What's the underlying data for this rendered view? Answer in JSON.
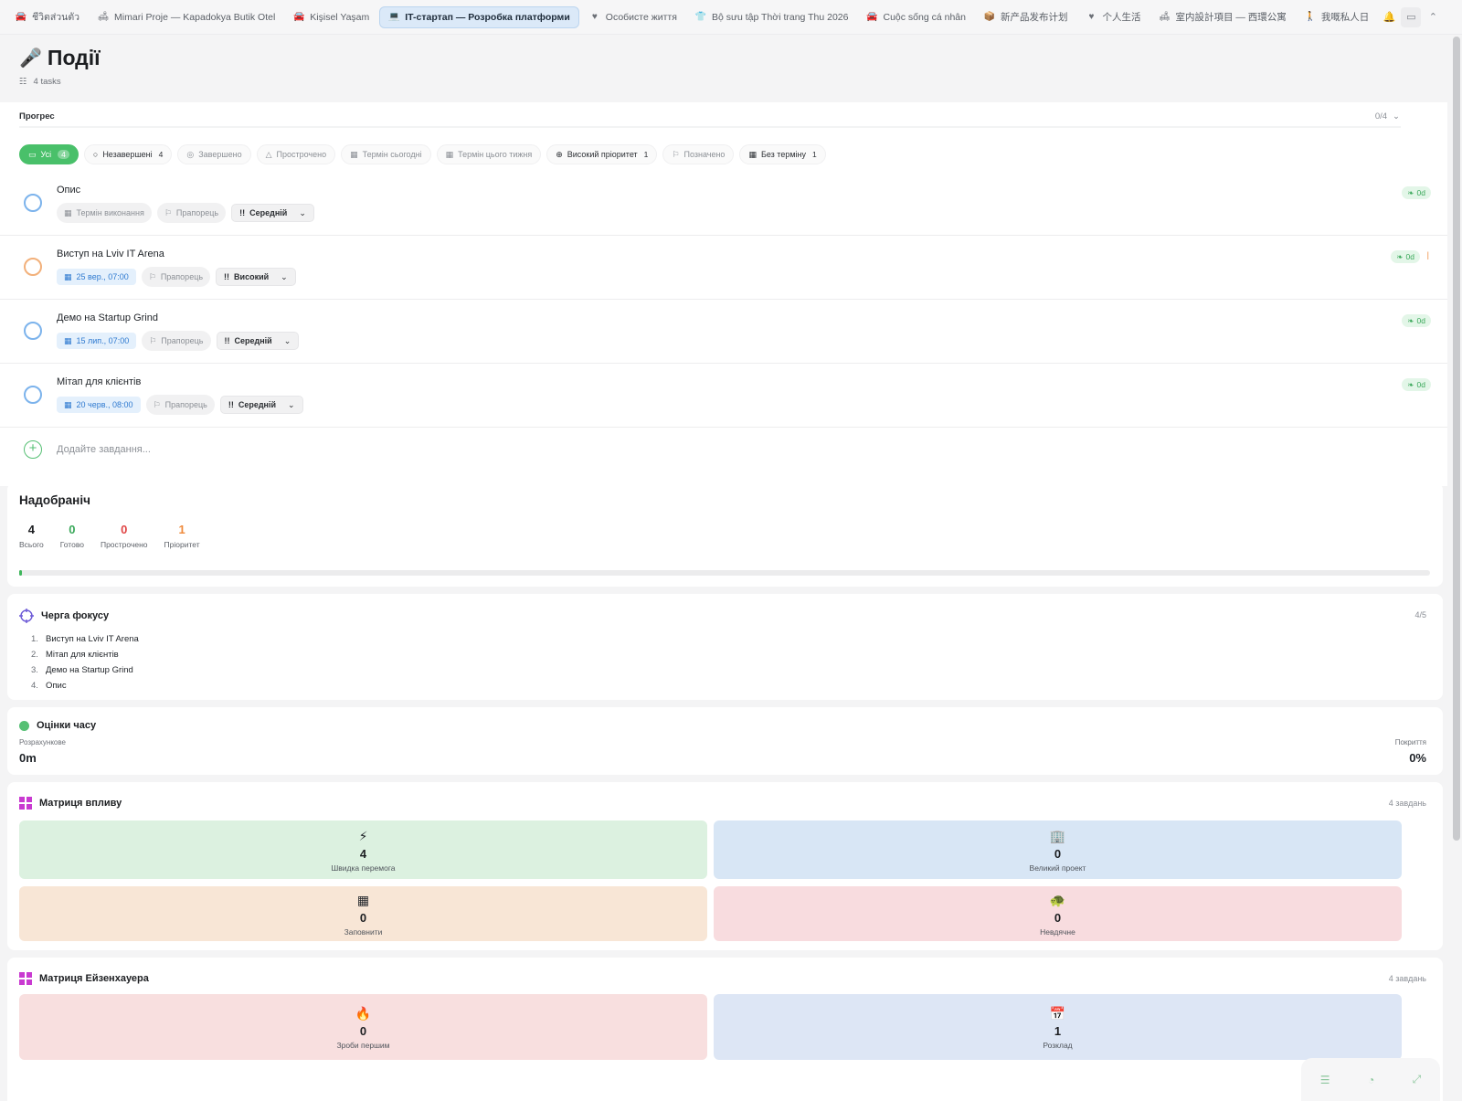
{
  "tabs": [
    {
      "label": "ชีวิตส่วนตัว",
      "icon": "car-icon",
      "glyph": "🚘"
    },
    {
      "label": "Mimari Proje — Kapadokya Butik Otel",
      "icon": "sofa-icon",
      "glyph": "🛋"
    },
    {
      "label": "Kişisel Yaşam",
      "icon": "car-icon",
      "glyph": "🚘"
    },
    {
      "label": "IT-стартап — Розробка платформи",
      "icon": "laptop-icon",
      "glyph": "💻",
      "active": true
    },
    {
      "label": "Особисте життя",
      "icon": "heart-icon",
      "glyph": "♥"
    },
    {
      "label": "Bộ sưu tập Thời trang Thu 2026",
      "icon": "shirt-icon",
      "glyph": "👕"
    },
    {
      "label": "Cuộc sống cá nhân",
      "icon": "car-icon",
      "glyph": "🚘"
    },
    {
      "label": "新产品发布计划",
      "icon": "box-icon",
      "glyph": "📦"
    },
    {
      "label": "个人生活",
      "icon": "heart-icon",
      "glyph": "♥"
    },
    {
      "label": "室内設計項目 — 西環公寓",
      "icon": "sofa-icon",
      "glyph": "🛋"
    },
    {
      "label": "我嘅私人日",
      "icon": "walking-icon",
      "glyph": "🚶"
    }
  ],
  "header": {
    "title": "Події",
    "title_icon": "microphone-icon",
    "subtitle": "4 tasks"
  },
  "progress": {
    "label": "Прогрес",
    "count": "0/4",
    "value": 0.0
  },
  "filters": [
    {
      "label": "Усі",
      "count": "4",
      "icon": "inbox-icon",
      "active": true
    },
    {
      "label": "Незавершені",
      "count": "4",
      "icon": "circle-icon",
      "dark": true
    },
    {
      "label": "Завершено",
      "count": "",
      "icon": "check-circle-icon"
    },
    {
      "label": "Прострочено",
      "count": "",
      "icon": "warning-icon"
    },
    {
      "label": "Термін сьогодні",
      "count": "",
      "icon": "calendar-icon"
    },
    {
      "label": "Термін цього тижня",
      "count": "",
      "icon": "calendar-icon"
    },
    {
      "label": "Високий пріоритет",
      "count": "1",
      "icon": "arrow-up-circle-icon",
      "dark": true
    },
    {
      "label": "Позначено",
      "count": "",
      "icon": "flag-icon"
    },
    {
      "label": "Без терміну",
      "count": "1",
      "icon": "calendar-off-icon",
      "dark": true
    }
  ],
  "tasks": [
    {
      "name": "Опис",
      "date": "Термін виконання",
      "has_date": false,
      "flag": "Прапорець",
      "priority": "Середній",
      "badge": "0d",
      "ring": "blue"
    },
    {
      "name": "Виступ на Lviv IT Arena",
      "date": "25 вер., 07:00",
      "has_date": true,
      "flag": "Прапорець",
      "priority": "Високий",
      "badge": "0d",
      "ring": "orange"
    },
    {
      "name": "Демо на Startup Grind",
      "date": "15 лип., 07:00",
      "has_date": true,
      "flag": "Прапорець",
      "priority": "Середній",
      "badge": "0d",
      "ring": "blue"
    },
    {
      "name": "Мітап для клієнтів",
      "date": "20 черв., 08:00",
      "has_date": true,
      "flag": "Прапорець",
      "priority": "Середній",
      "badge": "0d",
      "ring": "blue"
    }
  ],
  "add_task": {
    "placeholder": "Додайте завдання..."
  },
  "overview": {
    "title": "Надобраніч",
    "stats": [
      {
        "value": "4",
        "label": "Всього",
        "color": "#1c1e21"
      },
      {
        "value": "0",
        "label": "Готово",
        "color": "#3aa85a"
      },
      {
        "value": "0",
        "label": "Прострочено",
        "color": "#e04545"
      },
      {
        "value": "1",
        "label": "Пріоритет",
        "color": "#ef8a3c"
      }
    ],
    "completion": 0.0
  },
  "focus": {
    "title": "Черга фокусу",
    "ratio": "4/5",
    "items": [
      "Виступ на Lviv IT Arena",
      "Мітап для клієнтів",
      "Демо на Startup Grind",
      "Опис"
    ]
  },
  "time": {
    "title": "Оцінки часу",
    "estimate_label": "Розрахункове",
    "estimate_value": "0m",
    "coverage_label": "Покриття",
    "coverage_value": "0%"
  },
  "impact": {
    "title": "Матриця впливу",
    "count": "4 завдань",
    "cells": [
      {
        "value": "4",
        "label": "Швидка перемога",
        "icon": "lightning-icon",
        "glyph": "⚡",
        "bg": "#dcf1e0"
      },
      {
        "value": "0",
        "label": "Великий проект",
        "icon": "building-icon",
        "glyph": "🏢",
        "bg": "#d8e6f5"
      },
      {
        "value": "0",
        "label": "Заповнити",
        "icon": "grid-icon",
        "glyph": "▦",
        "bg": "#f8e6d6"
      },
      {
        "value": "0",
        "label": "Невдячне",
        "icon": "turtle-icon",
        "glyph": "🐢",
        "bg": "#f8dcdf"
      }
    ]
  },
  "eisenhower": {
    "title": "Матриця Ейзенхауера",
    "count": "4 завдань",
    "cells": [
      {
        "value": "0",
        "label": "Зроби першим",
        "icon": "fire-icon",
        "glyph": "🔥",
        "bg": "#f8dfdf"
      },
      {
        "value": "1",
        "label": "Розклад",
        "icon": "calendar-icon",
        "glyph": "📅",
        "bg": "#dde6f5"
      }
    ]
  },
  "colors": {
    "accent": "#49c06a",
    "tab_active": "#dbe9f8",
    "date_pill": "#2f7ad0"
  }
}
